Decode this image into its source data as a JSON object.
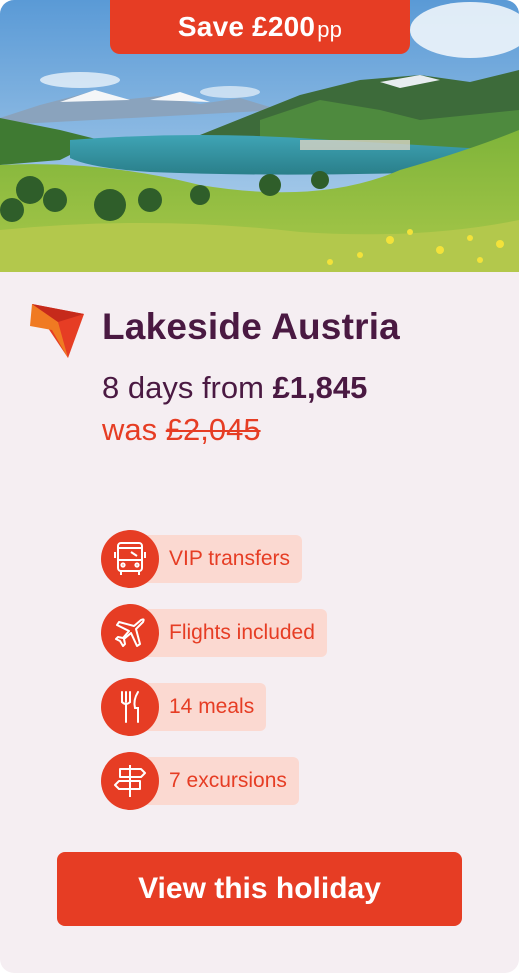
{
  "badge": {
    "save_label": "Save £200",
    "pp_label": "pp"
  },
  "hero": {
    "image_icon": "lake-mountain-landscape-image"
  },
  "card": {
    "title": "Lakeside Austria",
    "duration_prefix": "8 days from ",
    "price": "£1,845",
    "was_prefix": "was ",
    "old_price": "£2,045"
  },
  "features": [
    {
      "label": "VIP transfers",
      "icon": "bus-icon"
    },
    {
      "label": "Flights included",
      "icon": "plane-icon"
    },
    {
      "label": "14 meals",
      "icon": "cutlery-icon"
    },
    {
      "label": "7 excursions",
      "icon": "signpost-icon"
    }
  ],
  "cta": {
    "label": "View this holiday"
  },
  "colors": {
    "accent": "#e63d24",
    "title": "#4a1942",
    "pill": "#fbd9d1",
    "background": "#f5eef2"
  }
}
